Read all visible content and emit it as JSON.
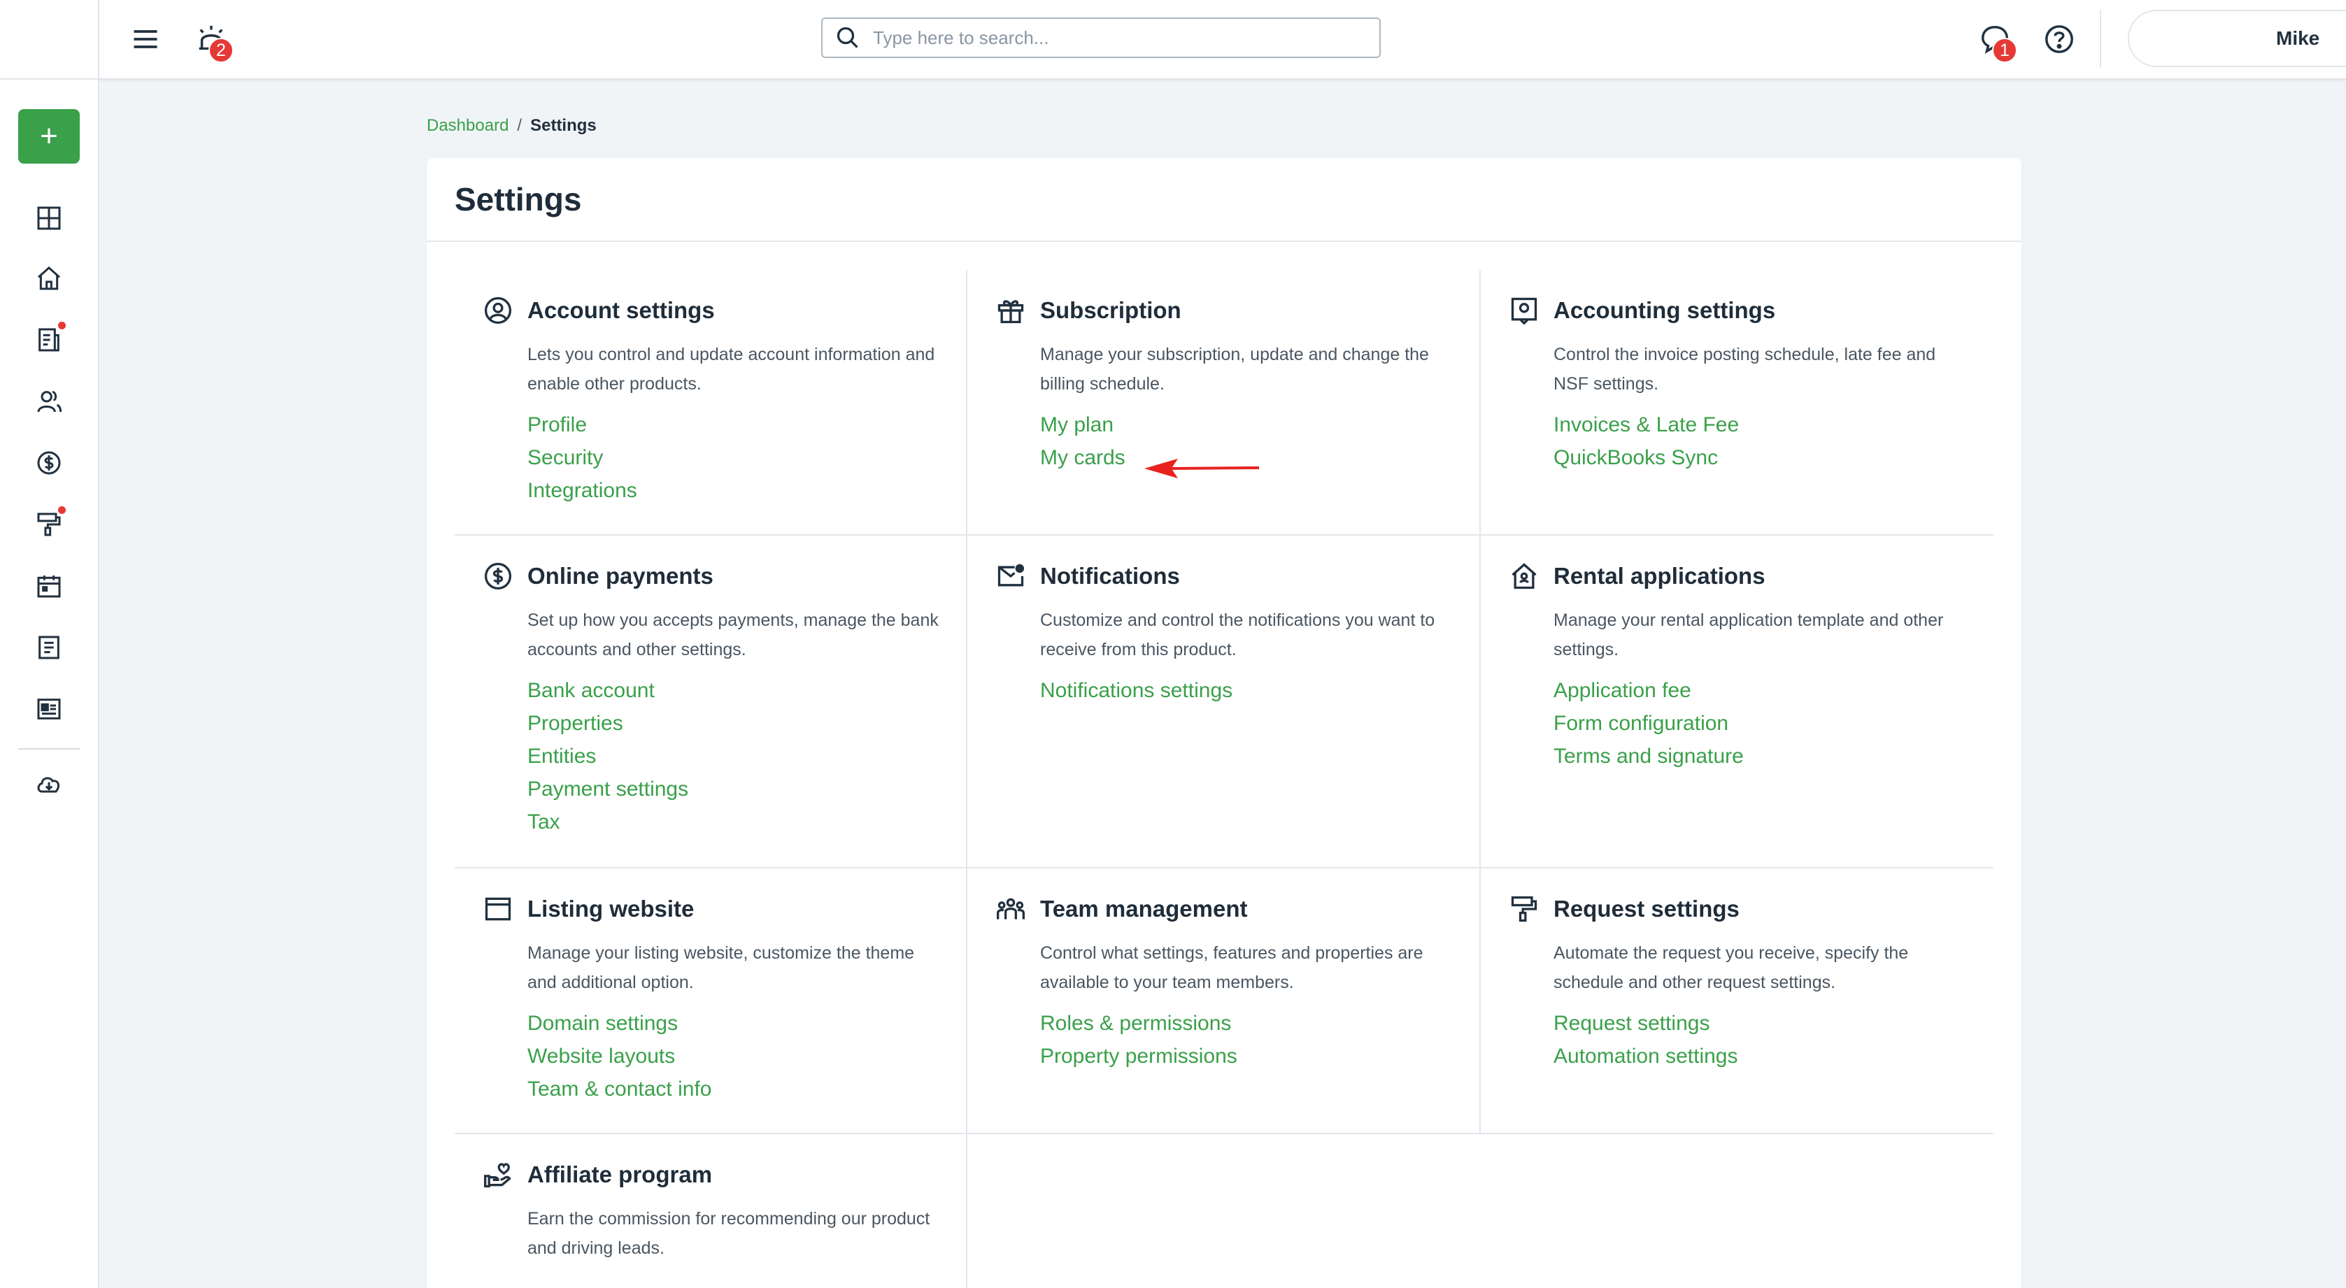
{
  "topbar": {
    "notifications_count": "2",
    "messages_count": "1",
    "search_placeholder": "Type here to search...",
    "user_name": "Mike"
  },
  "breadcrumb": {
    "parent": "Dashboard",
    "separator": "/",
    "current": "Settings"
  },
  "page": {
    "title": "Settings"
  },
  "sidebar": {
    "add_label": "+",
    "items": [
      "dashboard-icon",
      "home-icon",
      "leases-icon",
      "people-icon",
      "payments-icon",
      "maintenance-icon",
      "calendar-icon",
      "notes-icon",
      "listings-icon",
      "download-icon"
    ]
  },
  "sections": [
    {
      "title": "Account settings",
      "icon": "user-circle-icon",
      "desc": "Lets you control and update account information and enable other products.",
      "links": [
        "Profile",
        "Security",
        "Integrations"
      ]
    },
    {
      "title": "Subscription",
      "icon": "gift-icon",
      "desc": "Manage your subscription, update and change the billing schedule.",
      "links": [
        "My plan",
        "My cards"
      ]
    },
    {
      "title": "Accounting settings",
      "icon": "ledger-icon",
      "desc": "Control the invoice posting schedule, late fee and NSF settings.",
      "links": [
        "Invoices & Late Fee",
        "QuickBooks Sync"
      ]
    },
    {
      "title": "Online payments",
      "icon": "dollar-circle-icon",
      "desc": "Set up how you accepts payments, manage the bank accounts and other settings.",
      "links": [
        "Bank account",
        "Properties",
        "Entities",
        "Payment settings",
        "Tax"
      ]
    },
    {
      "title": "Notifications",
      "icon": "mail-icon",
      "desc": "Customize and control the notifications you want to receive from this product.",
      "links": [
        "Notifications settings"
      ]
    },
    {
      "title": "Rental applications",
      "icon": "house-icon",
      "desc": "Manage your rental application template and other settings.",
      "links": [
        "Application fee",
        "Form configuration",
        "Terms and signature"
      ]
    },
    {
      "title": "Listing website",
      "icon": "browser-icon",
      "desc": "Manage your listing website, customize the theme and additional option.",
      "links": [
        "Domain settings",
        "Website layouts",
        "Team & contact info"
      ]
    },
    {
      "title": "Team management",
      "icon": "team-icon",
      "desc": "Control what settings, features and properties are available to your team members.",
      "links": [
        "Roles & permissions",
        "Property permissions"
      ]
    },
    {
      "title": "Request settings",
      "icon": "paint-roller-icon",
      "desc": "Automate the request you receive, specify the schedule and other request settings.",
      "links": [
        "Request settings",
        "Automation settings"
      ]
    },
    {
      "title": "Affiliate program",
      "icon": "hand-heart-icon",
      "desc": "Earn the commission for recommending our product and driving leads.",
      "links": []
    }
  ],
  "colors": {
    "accent": "#3aa04a",
    "badge": "#e53935",
    "arrow": "#e8231f"
  }
}
